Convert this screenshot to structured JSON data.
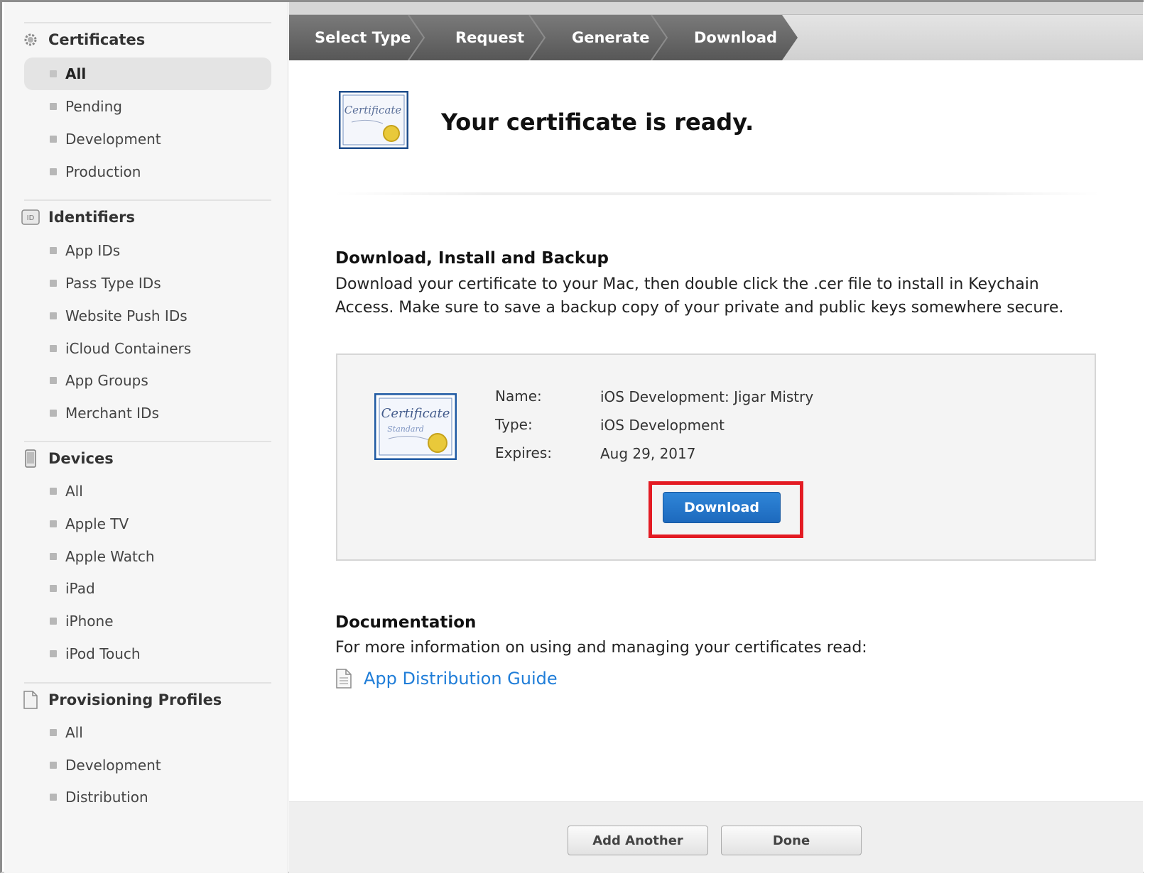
{
  "sidebar": {
    "certificates": {
      "title": "Certificates",
      "icon": "gear-certificate-icon",
      "items": [
        "All",
        "Pending",
        "Development",
        "Production"
      ],
      "selected": "All"
    },
    "identifiers": {
      "title": "Identifiers",
      "icon": "id-badge-icon",
      "icon_text": "ID",
      "items": [
        "App IDs",
        "Pass Type IDs",
        "Website Push IDs",
        "iCloud Containers",
        "App Groups",
        "Merchant IDs"
      ]
    },
    "devices": {
      "title": "Devices",
      "icon": "phone-device-icon",
      "items": [
        "All",
        "Apple TV",
        "Apple Watch",
        "iPad",
        "iPhone",
        "iPod Touch"
      ]
    },
    "profiles": {
      "title": "Provisioning Profiles",
      "icon": "document-profile-icon",
      "items": [
        "All",
        "Development",
        "Distribution"
      ]
    }
  },
  "steps": [
    "Select Type",
    "Request",
    "Generate",
    "Download"
  ],
  "hero": {
    "title": "Your certificate is ready.",
    "icon_text": "Certificate"
  },
  "download_section": {
    "title": "Download, Install and Backup",
    "text": "Download your certificate to your Mac, then double click the .cer file to install in Keychain Access. Make sure to save a backup copy of your private and public keys somewhere secure."
  },
  "certificate": {
    "icon_text": "Certificate",
    "icon_subtext": "Standard",
    "name_label": "Name:",
    "name_value": "iOS Development: Jigar Mistry",
    "type_label": "Type:",
    "type_value": "iOS Development",
    "expires_label": "Expires:",
    "expires_value": "Aug 29, 2017",
    "download_label": "Download"
  },
  "documentation": {
    "title": "Documentation",
    "text": "For more information on using and managing your certificates read:",
    "link_label": "App Distribution Guide"
  },
  "footer": {
    "add_another_label": "Add Another",
    "done_label": "Done"
  },
  "colors": {
    "link": "#1f7dd8",
    "primary_button": "#1d69bd",
    "highlight": "#e31b23"
  }
}
